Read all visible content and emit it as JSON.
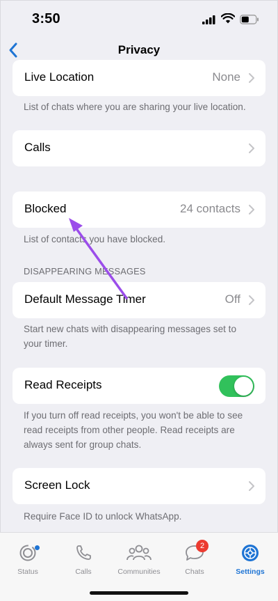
{
  "status_bar": {
    "time": "3:50"
  },
  "nav": {
    "title": "Privacy"
  },
  "rows": {
    "live_location": {
      "label": "Live Location",
      "value": "None",
      "footer": "List of chats where you are sharing your live location."
    },
    "calls": {
      "label": "Calls"
    },
    "blocked": {
      "label": "Blocked",
      "value": "24 contacts",
      "footer": "List of contacts you have blocked."
    },
    "disappearing": {
      "section_header": "DISAPPEARING MESSAGES",
      "label": "Default Message Timer",
      "value": "Off",
      "footer_line1": "Start new chats with disappearing messages set to",
      "footer_line2": "your timer."
    },
    "read_receipts": {
      "label": "Read Receipts",
      "enabled": true,
      "footer_line1": "If you turn off read receipts, you won't be able to see",
      "footer_line2": "read receipts from other people. Read receipts are",
      "footer_line3": "always sent for group chats."
    },
    "screen_lock": {
      "label": "Screen Lock",
      "footer": "Require Face ID to unlock WhatsApp."
    }
  },
  "tabbar": {
    "tabs": [
      {
        "label": "Status",
        "icon": "status-icon"
      },
      {
        "label": "Calls",
        "icon": "phone-icon"
      },
      {
        "label": "Communities",
        "icon": "communities-icon"
      },
      {
        "label": "Chats",
        "icon": "chats-icon",
        "badge": "2"
      },
      {
        "label": "Settings",
        "icon": "settings-icon",
        "active": true
      }
    ]
  },
  "colors": {
    "accent": "#1e74d4",
    "toggle_on": "#31c15b",
    "badge": "#ec3b30",
    "annotation_arrow": "#9b4dea"
  }
}
